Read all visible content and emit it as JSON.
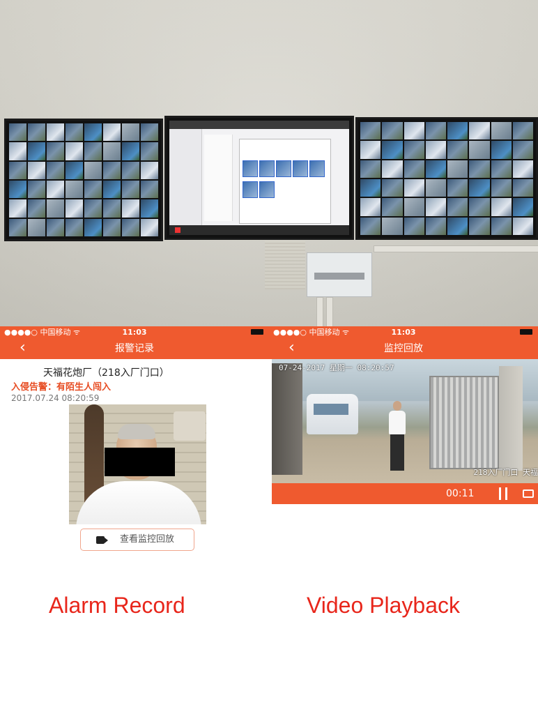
{
  "photo": {
    "monitors": [
      "camera-grid-left",
      "management-software",
      "camera-grid-right"
    ]
  },
  "left_phone": {
    "status": {
      "carrier": "●●●●○ 中国移动 ᯤ",
      "time": "11:03"
    },
    "nav": {
      "back_icon": "‹",
      "title": "报警记录"
    },
    "alarm": {
      "source": "天福花炮厂（218入厂门口）",
      "title": "入侵告警：有陌生人闯入",
      "time": "2017.07.24 08:20:59"
    },
    "playback_button": {
      "label": "查看监控回放",
      "icon": "video-camera-icon"
    },
    "caption": "Alarm Record"
  },
  "right_phone": {
    "status": {
      "carrier": "●●●●○ 中国移动 ᯤ",
      "time": "11:03"
    },
    "nav": {
      "back_icon": "‹",
      "title": "监控回放"
    },
    "video": {
      "timestamp_osd": "07-24-2017 星期一 08:20:57",
      "location_osd": "218入厂门口 天福"
    },
    "controls": {
      "elapsed": "00:11",
      "pause_icon": "pause-icon",
      "fullscreen_icon": "fullscreen-icon"
    },
    "caption": "Video Playback"
  }
}
